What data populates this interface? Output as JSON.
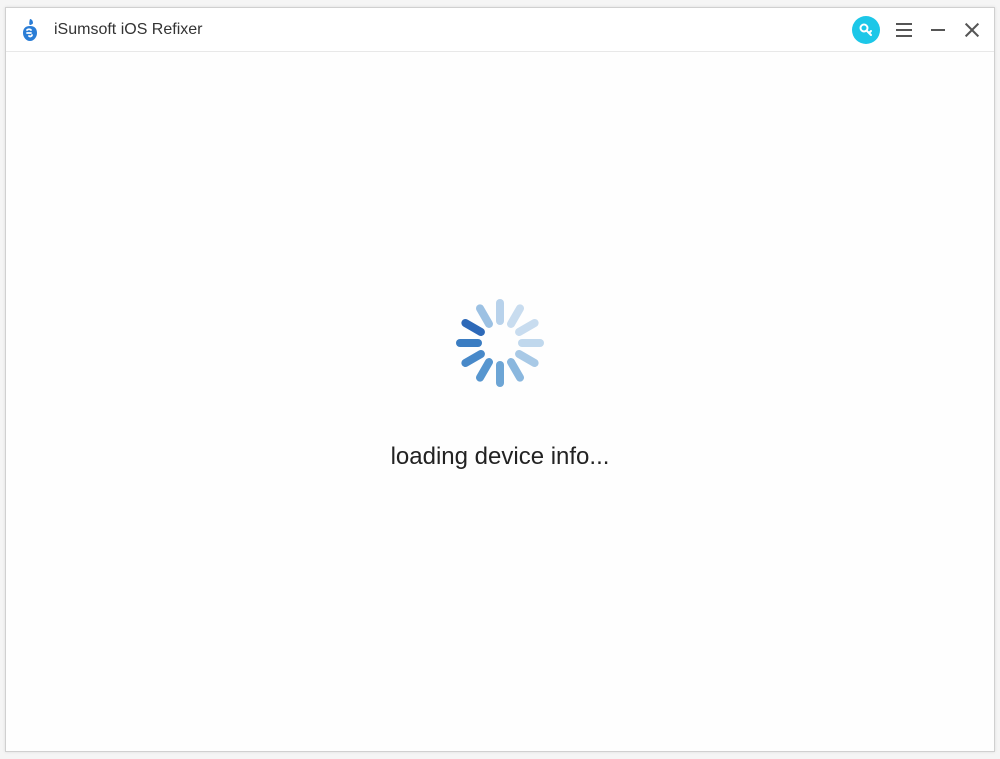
{
  "app": {
    "title": "iSumsoft iOS Refixer"
  },
  "content": {
    "status_message": "loading device info..."
  },
  "colors": {
    "accent": "#1cc7e8",
    "logo": "#2a7dd6",
    "spinner_dark": "#2d69b8",
    "spinner_light": "#c8dcef"
  },
  "spinner": {
    "blades": [
      {
        "rotation": 0,
        "color": "#b8d2eb"
      },
      {
        "rotation": 30,
        "color": "#c8dcef"
      },
      {
        "rotation": 60,
        "color": "#c8dcef"
      },
      {
        "rotation": 90,
        "color": "#c0d8ed"
      },
      {
        "rotation": 120,
        "color": "#a8c9e6"
      },
      {
        "rotation": 150,
        "color": "#8ab7de"
      },
      {
        "rotation": 180,
        "color": "#6da5d5"
      },
      {
        "rotation": 210,
        "color": "#5796cf"
      },
      {
        "rotation": 240,
        "color": "#4889c9"
      },
      {
        "rotation": 270,
        "color": "#3b7dc2"
      },
      {
        "rotation": 300,
        "color": "#2d69b8"
      },
      {
        "rotation": 330,
        "color": "#9cc1e3"
      }
    ]
  }
}
